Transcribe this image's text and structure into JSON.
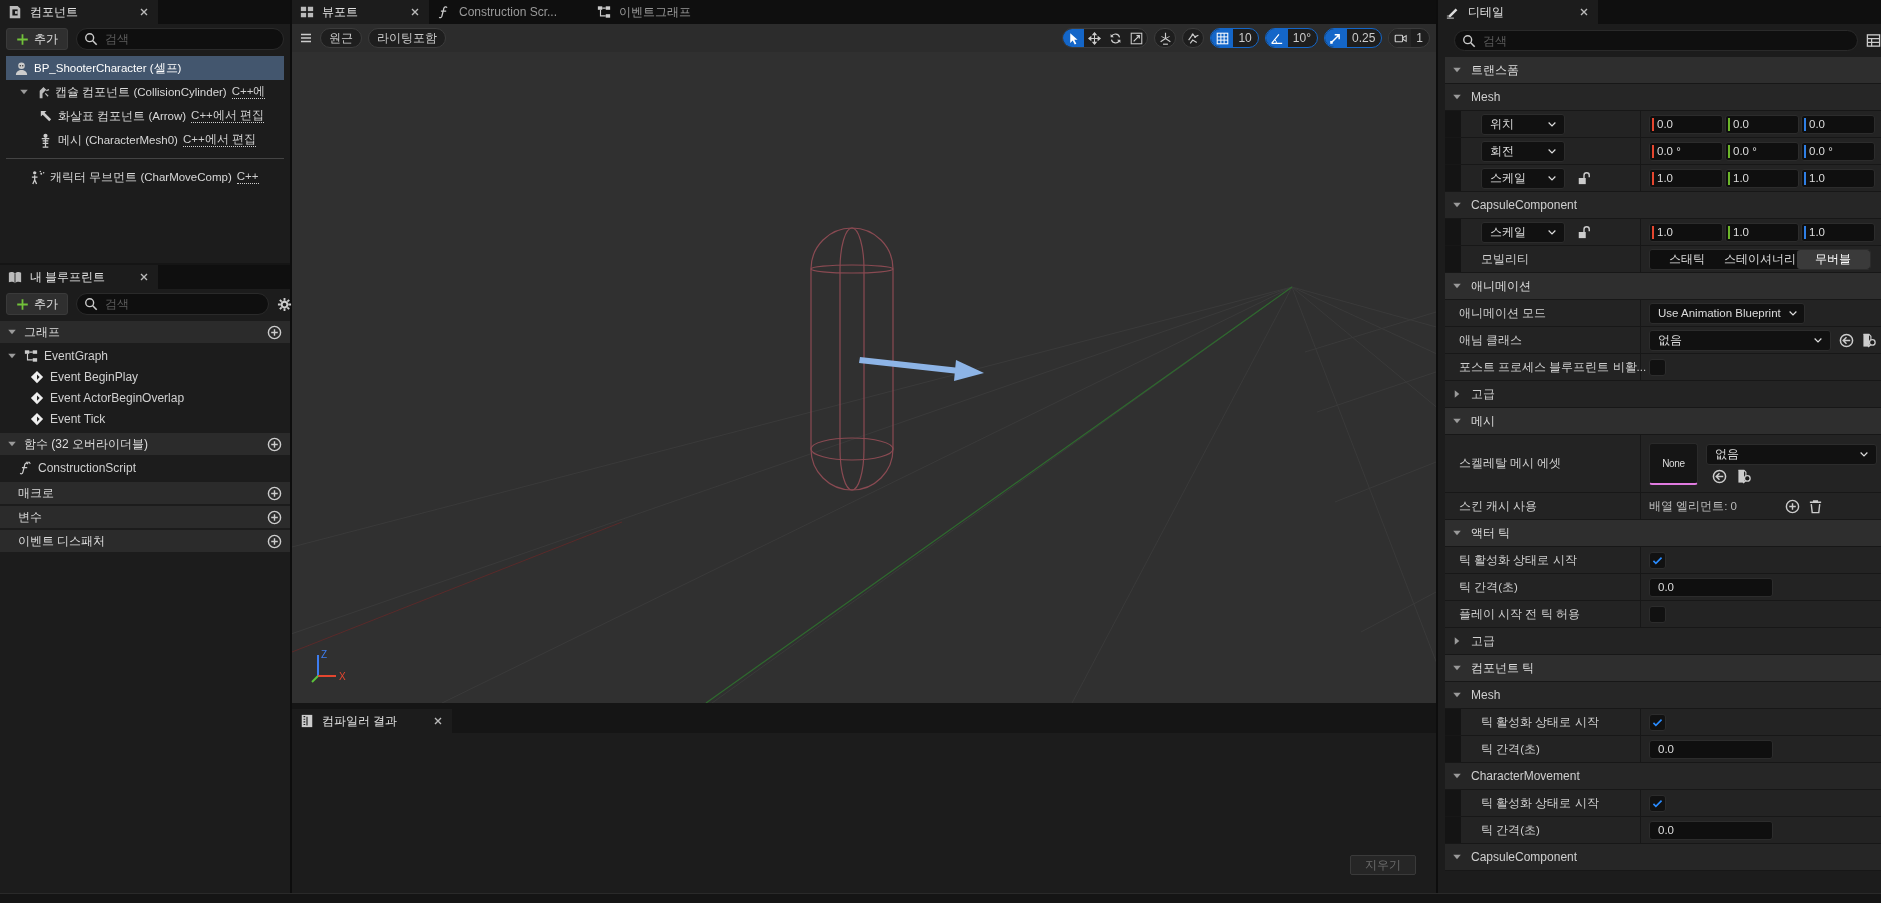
{
  "components": {
    "tab": "컴포넌트",
    "add_button": "추가",
    "search_placeholder": "검색",
    "tree": [
      {
        "label": "BP_ShooterCharacter (셀프)",
        "selected": true,
        "kind": "self",
        "children": [
          {
            "label": "캡슐 컴포넌트 (CollisionCylinder)",
            "note": "C++에",
            "selected": false,
            "kind": "capsule",
            "expanded": true,
            "children": [
              {
                "label": "화살표 컴포넌트 (Arrow)",
                "note": "C++에서 편집",
                "selected": false,
                "kind": "arrow"
              },
              {
                "label": "메시 (CharacterMesh0)",
                "note": "C++에서 편집",
                "selected": false,
                "kind": "mesh"
              }
            ]
          }
        ]
      }
    ],
    "other_components": [
      {
        "label": "캐릭터 무브먼트 (CharMoveComp)",
        "note": "C++",
        "selected": false,
        "kind": "movement"
      }
    ]
  },
  "my_blueprint": {
    "tab": "내 블루프린트",
    "add_button": "추가",
    "search_placeholder": "검색",
    "sections": [
      {
        "title": "그래프",
        "kind": "group",
        "expanded": true,
        "items": [
          {
            "label": "EventGraph",
            "kind": "graph",
            "expanded": true,
            "children": [
              {
                "label": "Event BeginPlay",
                "kind": "event"
              },
              {
                "label": "Event ActorBeginOverlap",
                "kind": "event"
              },
              {
                "label": "Event Tick",
                "kind": "event"
              }
            ]
          }
        ]
      },
      {
        "title": "함수 (32 오버라이더블)",
        "kind": "group",
        "expanded": true,
        "items": [
          {
            "label": "ConstructionScript",
            "kind": "function"
          }
        ]
      },
      {
        "title": "매크로",
        "kind": "empty"
      },
      {
        "title": "변수",
        "kind": "empty"
      },
      {
        "title": "이벤트 디스패처",
        "kind": "empty"
      }
    ]
  },
  "viewport": {
    "tabs": [
      {
        "label": "뷰포트",
        "selected": true,
        "kind": "viewport"
      },
      {
        "label": "Construction Scr...",
        "selected": false,
        "kind": "function"
      },
      {
        "label": "이벤트그래프",
        "selected": false,
        "kind": "graph"
      }
    ],
    "view_buttons": [
      "원근",
      "라이팅포함"
    ],
    "transform_tools": [
      {
        "kind": "select",
        "on": true
      },
      {
        "kind": "move",
        "on": false
      },
      {
        "kind": "rotate",
        "on": false
      },
      {
        "kind": "scale",
        "on": false
      }
    ],
    "snaps": [
      {
        "kind": "grid",
        "on": true,
        "value": "10"
      },
      {
        "kind": "angle",
        "on": true,
        "value": "10°"
      },
      {
        "kind": "scale",
        "on": true,
        "value": "0.25"
      },
      {
        "kind": "camera",
        "on": false,
        "value": "1"
      }
    ],
    "axes": [
      "Z",
      "X"
    ]
  },
  "compiler_results": {
    "tab": "컴파일러 결과",
    "clear_button": {
      "label": "지우기",
      "disabled": true
    }
  },
  "details": {
    "tab": "디테일",
    "search_placeholder": "검색",
    "sections": [
      {
        "kind": "category",
        "title": "트랜스폼",
        "expanded": true,
        "children": [
          {
            "kind": "group",
            "title": "Mesh",
            "expanded": true,
            "children": [
              {
                "kind": "vector",
                "label": "위치",
                "values": [
                  "0.0",
                  "0.0",
                  "0.0"
                ]
              },
              {
                "kind": "vector",
                "label": "회전",
                "values": [
                  "0.0 °",
                  "0.0 °",
                  "0.0 °"
                ]
              },
              {
                "kind": "vector",
                "label": "스케일",
                "locked": false,
                "values": [
                  "1.0",
                  "1.0",
                  "1.0"
                ]
              }
            ]
          },
          {
            "kind": "group",
            "title": "CapsuleComponent",
            "expanded": true,
            "children": [
              {
                "kind": "vector",
                "label": "스케일",
                "locked": false,
                "values": [
                  "1.0",
                  "1.0",
                  "1.0"
                ]
              },
              {
                "kind": "segmented",
                "label": "모빌리티",
                "options": [
                  {
                    "label": "스태틱",
                    "selected": false
                  },
                  {
                    "label": "스테이셔너리",
                    "selected": false
                  },
                  {
                    "label": "무버블",
                    "selected": true
                  }
                ]
              }
            ]
          }
        ]
      },
      {
        "kind": "category",
        "title": "애니메이션",
        "expanded": true,
        "children": [
          {
            "kind": "dropdown",
            "label": "애니메이션 모드",
            "value": "Use Animation Blueprint"
          },
          {
            "kind": "picker",
            "label": "애님 클래스",
            "value": "없음"
          },
          {
            "kind": "checkbox",
            "label": "포스트 프로세스 블루프린트 비활...",
            "checked": false
          },
          {
            "kind": "advanced",
            "title": "고급",
            "expanded": false
          }
        ]
      },
      {
        "kind": "category",
        "title": "메시",
        "expanded": true,
        "children": [
          {
            "kind": "asset",
            "label": "스켈레탈 메시 에셋",
            "thumbnail": "None",
            "value": "없음"
          },
          {
            "kind": "array",
            "label": "스킨 캐시 사용",
            "value": "배열 엘리먼트: 0"
          }
        ]
      },
      {
        "kind": "category",
        "title": "액터 틱",
        "expanded": true,
        "children": [
          {
            "kind": "checkbox",
            "label": "틱 활성화 상태로 시작",
            "checked": true
          },
          {
            "kind": "number",
            "label": "틱 간격(초)",
            "value": "0.0"
          },
          {
            "kind": "checkbox",
            "label": "플레이 시작 전 틱 허용",
            "checked": false
          },
          {
            "kind": "advanced",
            "title": "고급",
            "expanded": false
          }
        ]
      },
      {
        "kind": "category",
        "title": "컴포넌트 틱",
        "expanded": true,
        "children": [
          {
            "kind": "group",
            "title": "Mesh",
            "expanded": true,
            "children": [
              {
                "kind": "checkbox",
                "label": "틱 활성화 상태로 시작",
                "checked": true
              },
              {
                "kind": "number",
                "label": "틱 간격(초)",
                "value": "0.0"
              }
            ]
          },
          {
            "kind": "group",
            "title": "CharacterMovement",
            "expanded": true,
            "children": [
              {
                "kind": "checkbox",
                "label": "틱 활성화 상태로 시작",
                "checked": true
              },
              {
                "kind": "number",
                "label": "틱 간격(초)",
                "value": "0.0"
              }
            ]
          },
          {
            "kind": "group",
            "title": "CapsuleComponent",
            "expanded": true
          }
        ]
      }
    ]
  }
}
